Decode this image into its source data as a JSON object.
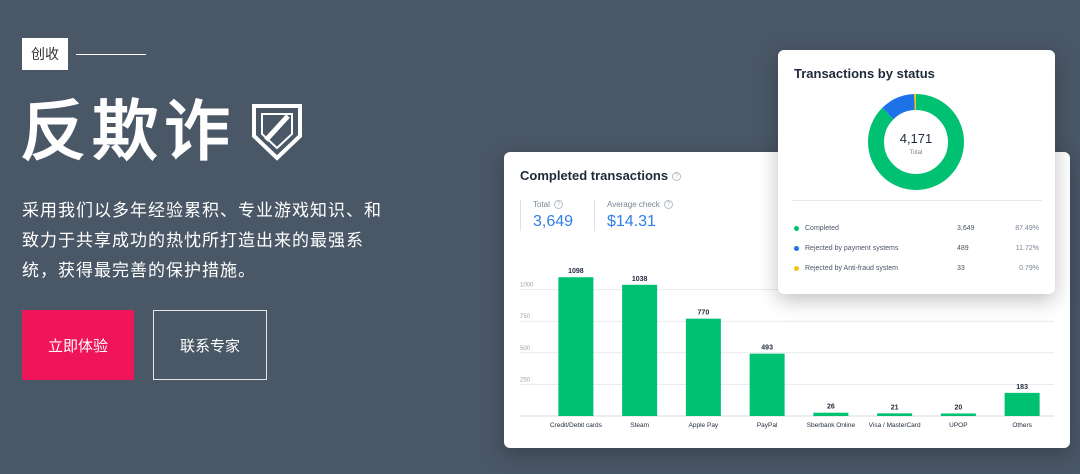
{
  "hero": {
    "tag": "创收",
    "title": "反欺诈",
    "description": "采用我们以多年经验累积、专业游戏知识、和致力于共享成功的热忱所打造出来的最强系统，获得最完善的保护措施。",
    "primary_button": "立即体验",
    "secondary_button": "联系专家"
  },
  "completed": {
    "title": "Completed transactions",
    "info": "?",
    "total_label": "Total",
    "total_value": "3,649",
    "avg_label": "Average check",
    "avg_value": "$14.31"
  },
  "status": {
    "title": "Transactions by status",
    "center_value": "4,171",
    "center_label": "Total",
    "rows": [
      {
        "name": "Completed",
        "count": "3,649",
        "pct": "87.49%",
        "color": "#00c072"
      },
      {
        "name": "Rejected by payment systems",
        "count": "489",
        "pct": "11.72%",
        "color": "#1d72e8"
      },
      {
        "name": "Rejected by Anti-fraud system",
        "count": "33",
        "pct": "0.79%",
        "color": "#f3c614"
      }
    ]
  },
  "chart_data": [
    {
      "type": "bar",
      "title": "Completed transactions",
      "categories": [
        "Credit/Debit cards",
        "Steam",
        "Apple Pay",
        "PayPal",
        "Sberbank Online",
        "Visa / MasterCard",
        "UPOP",
        "Others"
      ],
      "values": [
        1098,
        1038,
        770,
        493,
        26,
        21,
        20,
        183
      ],
      "ylim": [
        0,
        1250
      ],
      "yticks": [
        250,
        500,
        750,
        1000
      ],
      "grid": true,
      "color": "#00c072"
    },
    {
      "type": "pie",
      "title": "Transactions by status",
      "categories": [
        "Completed",
        "Rejected by payment systems",
        "Rejected by Anti-fraud system"
      ],
      "values": [
        3649,
        489,
        33
      ],
      "colors": [
        "#00c072",
        "#1d72e8",
        "#f3c614"
      ]
    }
  ]
}
